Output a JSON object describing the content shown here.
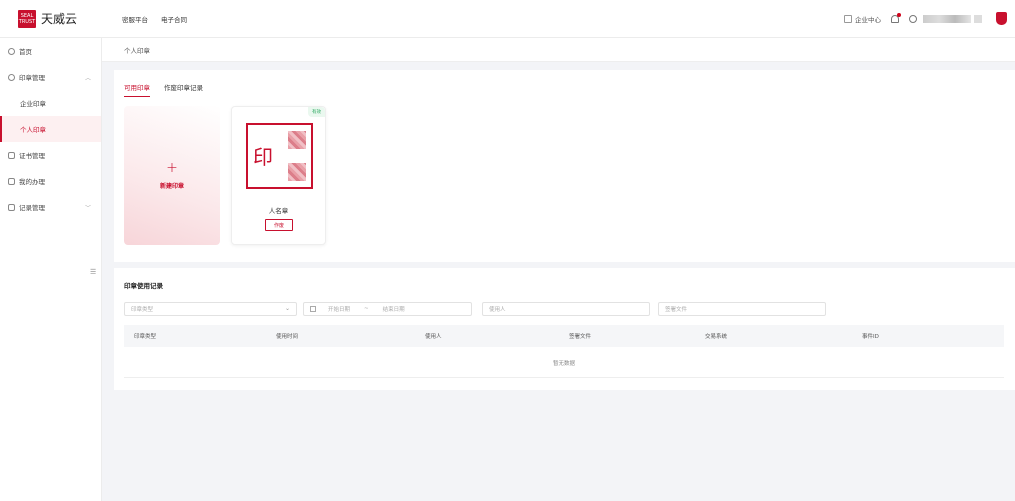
{
  "brand": {
    "logo_text": "天威云",
    "logo_mark_line1": "SEAL",
    "logo_mark_line2": "TRUST"
  },
  "topnav": [
    "密服平台",
    "电子合同"
  ],
  "header": {
    "enterprise_center": "企业中心"
  },
  "sidebar": {
    "items": [
      {
        "label": "首页",
        "icon": "home-icon"
      },
      {
        "label": "印章管理",
        "icon": "seal-icon",
        "expanded": true
      },
      {
        "label": "企业印章",
        "sub": true
      },
      {
        "label": "个人印章",
        "sub": true,
        "active": true
      },
      {
        "label": "证书管理",
        "icon": "certificate-icon"
      },
      {
        "label": "我的办理",
        "icon": "task-icon"
      },
      {
        "label": "记录管理",
        "icon": "record-icon",
        "expanded": false
      }
    ]
  },
  "breadcrumb": "个人印章",
  "tabs": [
    "可用印章",
    "作废印章记录"
  ],
  "new_seal_label": "新建印章",
  "seal_card": {
    "status": "有效",
    "seal_char": "印",
    "name": "人名章",
    "void_label": "作废"
  },
  "records": {
    "title": "印章使用记录",
    "filters": {
      "seal_type_placeholder": "印章类型",
      "start_date": "开始日期",
      "date_sep": "~",
      "end_date": "结束日期",
      "user_placeholder": "使用人",
      "file_placeholder": "签署文件"
    },
    "columns": [
      "印章类型",
      "使用时间",
      "使用人",
      "签署文件",
      "交易系统",
      "事件ID"
    ],
    "empty_text": "暂无数据"
  },
  "colors": {
    "accent": "#c8102e",
    "valid": "#25a55b"
  }
}
